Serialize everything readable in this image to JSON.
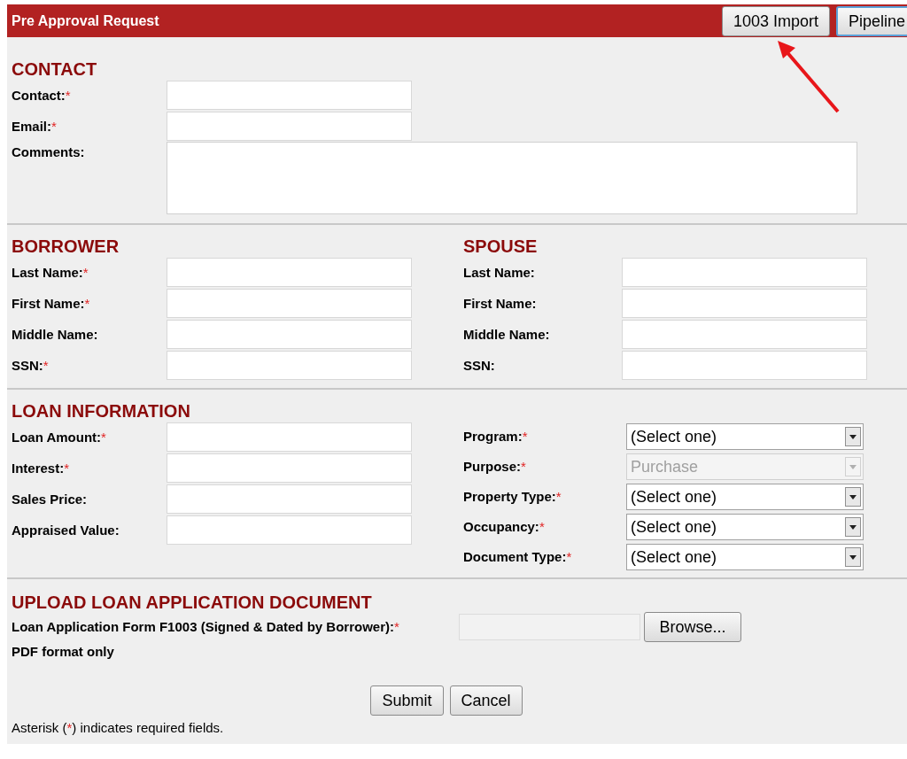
{
  "header": {
    "title": "Pre Approval Request",
    "buttons": [
      "1003 Import",
      "Pipeline"
    ]
  },
  "contact": {
    "heading": "CONTACT",
    "fields": [
      {
        "label": "Contact:",
        "required_mark": "*"
      },
      {
        "label": "Email:",
        "required_mark": "*"
      }
    ],
    "comments_label": "Comments:"
  },
  "borrower": {
    "heading": "BORROWER",
    "fields": [
      {
        "label": "Last Name:",
        "required_mark": "*"
      },
      {
        "label": "First Name:",
        "required_mark": "*"
      },
      {
        "label": "Middle Name:"
      },
      {
        "label": "SSN:",
        "required_mark": "*"
      }
    ]
  },
  "spouse": {
    "heading": "SPOUSE",
    "fields": [
      {
        "label": "Last Name:"
      },
      {
        "label": "First Name:"
      },
      {
        "label": "Middle Name:"
      },
      {
        "label": "SSN:"
      }
    ]
  },
  "loan_information": {
    "heading": "LOAN INFORMATION",
    "fields": [
      {
        "label": "Loan Amount:",
        "required_mark": "*"
      },
      {
        "label": "Interest:",
        "required_mark": "*"
      },
      {
        "label": "Sales Price:"
      },
      {
        "label": "Appraised Value:"
      }
    ],
    "selects": [
      {
        "label": "Program:",
        "required_mark": "*",
        "value": "(Select one)",
        "disabled": false
      },
      {
        "label": "Purpose:",
        "required_mark": "*",
        "value": "Purchase",
        "disabled": true
      },
      {
        "label": "Property Type:",
        "required_mark": "*",
        "value": "(Select one)",
        "disabled": false
      },
      {
        "label": "Occupancy:",
        "required_mark": "*",
        "value": "(Select one)",
        "disabled": false
      },
      {
        "label": "Document Type:",
        "required_mark": "*",
        "value": "(Select one)",
        "disabled": false
      }
    ]
  },
  "upload": {
    "heading": "UPLOAD LOAN APPLICATION DOCUMENT",
    "label": "Loan Application Form F1003 (Signed & Dated by Borrower):",
    "required_mark": "*",
    "note": "PDF format only",
    "browse_button": "Browse..."
  },
  "actions": [
    "Submit",
    "Cancel"
  ],
  "footer": {
    "before": "Asterisk (",
    "mark": "*",
    "after": ") indicates required fields."
  }
}
